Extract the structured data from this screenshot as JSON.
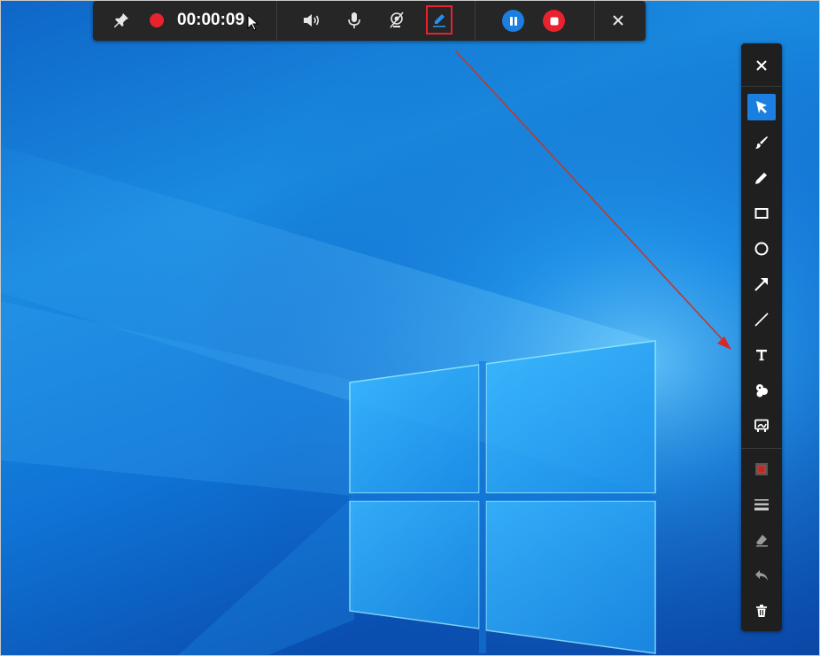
{
  "recording_toolbar": {
    "timer": "00:00:09",
    "pin_icon": "pin-icon",
    "record_indicator_icon": "record-dot-icon",
    "speaker_icon": "speaker-icon",
    "microphone_icon": "microphone-icon",
    "camera_off_icon": "camera-off-icon",
    "draw_icon": "pen-draw-icon",
    "pause_icon": "pause-icon",
    "stop_icon": "stop-icon",
    "close_icon": "close-icon"
  },
  "annotation_toolbar": {
    "tools": [
      {
        "name": "close",
        "icon": "close-icon"
      },
      {
        "name": "select",
        "icon": "cursor-select-icon",
        "active": true
      },
      {
        "name": "brush",
        "icon": "brush-icon"
      },
      {
        "name": "pencil",
        "icon": "pencil-icon"
      },
      {
        "name": "rectangle",
        "icon": "rectangle-icon"
      },
      {
        "name": "ellipse",
        "icon": "ellipse-icon"
      },
      {
        "name": "arrow",
        "icon": "arrow-icon"
      },
      {
        "name": "line",
        "icon": "line-icon"
      },
      {
        "name": "text",
        "icon": "text-icon"
      },
      {
        "name": "number-marker",
        "icon": "number-marker-icon"
      },
      {
        "name": "highlight",
        "icon": "highlight-icon"
      },
      {
        "name": "color",
        "icon": "color-swatch-icon"
      },
      {
        "name": "line-width",
        "icon": "line-width-icon"
      },
      {
        "name": "eraser",
        "icon": "eraser-icon"
      },
      {
        "name": "undo",
        "icon": "undo-icon"
      },
      {
        "name": "delete",
        "icon": "trash-icon"
      }
    ]
  },
  "colors": {
    "record_red": "#e8222e",
    "accent_blue": "#1a7fe0",
    "toolbar_bg": "#262626",
    "annotation_color": "#c0392b"
  }
}
